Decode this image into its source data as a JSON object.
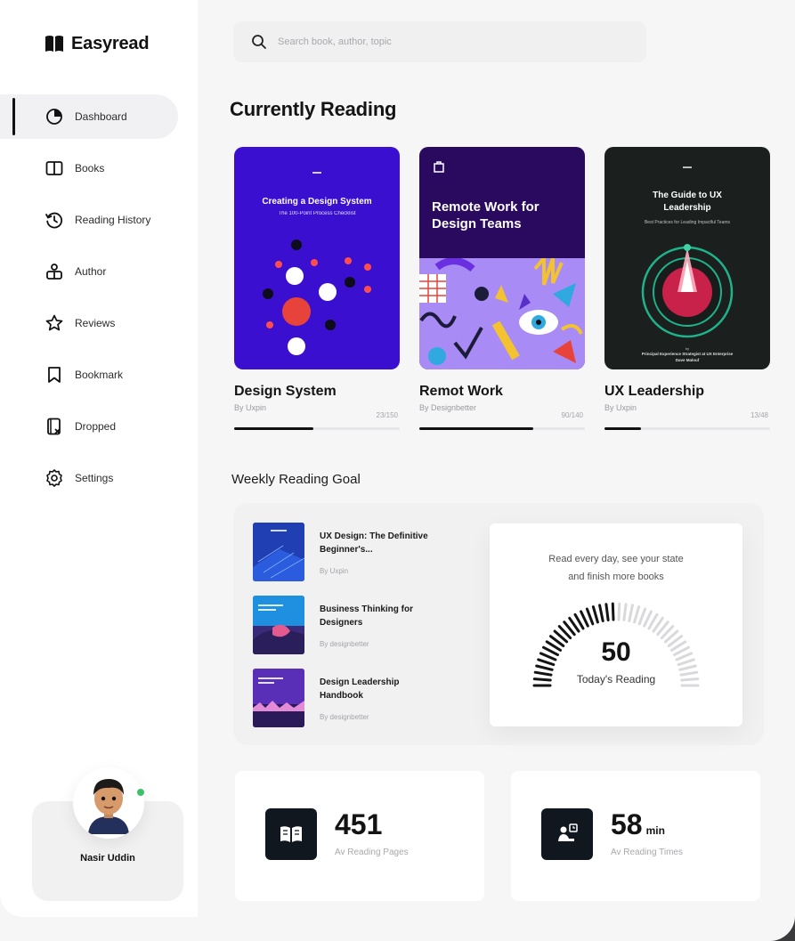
{
  "brand": {
    "name": "Easyread"
  },
  "nav": [
    {
      "label": "Dashboard",
      "icon": "pie-chart-icon",
      "active": true
    },
    {
      "label": "Books",
      "icon": "book-open-icon"
    },
    {
      "label": "Reading History",
      "icon": "history-icon"
    },
    {
      "label": "Author",
      "icon": "author-icon"
    },
    {
      "label": "Reviews",
      "icon": "star-icon"
    },
    {
      "label": "Bookmark",
      "icon": "bookmark-icon"
    },
    {
      "label": "Dropped",
      "icon": "dropped-book-icon"
    },
    {
      "label": "Settings",
      "icon": "gear-icon"
    }
  ],
  "profile": {
    "name": "Nasir Uddin",
    "status_color": "#3fbf6b"
  },
  "search": {
    "placeholder": "Search book, author, topic"
  },
  "currently_reading": {
    "title": "Currently Reading",
    "books": [
      {
        "title": "Design System",
        "author": "By Uxpin",
        "pages": "23/150",
        "progress": 0.48,
        "cover_bg": "#3a0fcf",
        "cover_title": "Creating a Design System",
        "cover_subtitle": "The 100-Point Process Checklist"
      },
      {
        "title": "Remot Work",
        "author": "By Designbetter",
        "pages": "90/140",
        "progress": 0.69,
        "cover_bg": "#2a0a5e",
        "cover_title": "Remote Work for Design Teams"
      },
      {
        "title": "UX Leadership",
        "author": "By Uxpin",
        "pages": "13/48",
        "progress": 0.22,
        "cover_bg": "#1b1f1e",
        "cover_title": "The Guide to UX Leadership",
        "cover_subtitle": "Best Practices for Leading Impactful Teams",
        "cover_footer_1": "by",
        "cover_footer_2": "Principal Experience Strategist at UX Enterprise",
        "cover_footer_3": "Dave Malouf"
      }
    ]
  },
  "weekly": {
    "title": "Weekly Reading Goal",
    "items": [
      {
        "title": "UX Design: The Definitive Beginner's...",
        "author": "By Uxpin",
        "thumb_color": "#1f3fb3"
      },
      {
        "title": "Business Thinking for Designers",
        "author": "By designbetter",
        "thumb_color": "#1e4fae"
      },
      {
        "title": "Design Leadership Handbook",
        "author": "By designbetter",
        "thumb_color": "#4b2aa0"
      }
    ],
    "goal": {
      "line1": "Read every day, see your state",
      "line2": "and finish more books",
      "value": "50",
      "label": "Today's Reading",
      "fraction": 0.5
    }
  },
  "stats": [
    {
      "value": "451",
      "unit": "",
      "label": "Av Reading Pages",
      "icon": "open-book-icon"
    },
    {
      "value": "58",
      "unit": "min",
      "label": "Av Reading Times",
      "icon": "reader-icon"
    }
  ]
}
